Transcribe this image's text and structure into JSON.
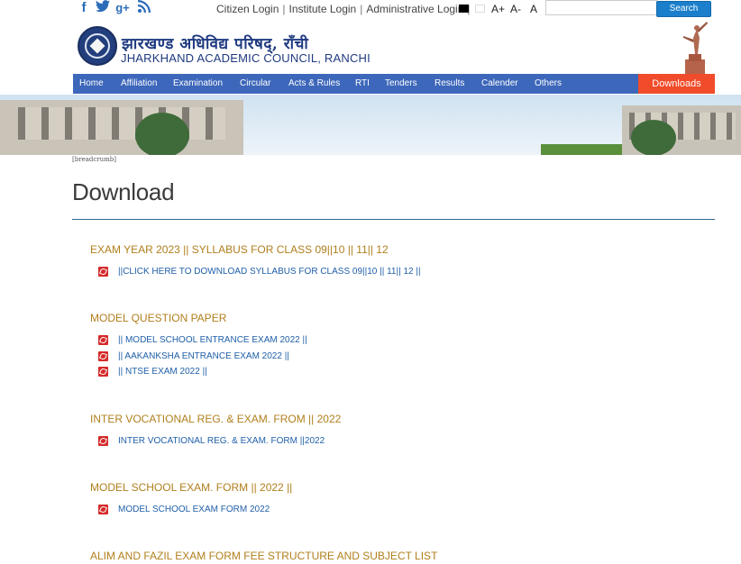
{
  "topbar": {
    "social": [
      {
        "name": "facebook-icon",
        "glyph": "f"
      },
      {
        "name": "twitter-icon",
        "glyph": "t"
      },
      {
        "name": "google-plus-icon",
        "glyph": "g+"
      },
      {
        "name": "rss-icon",
        "glyph": "rss"
      }
    ],
    "links": [
      "Citizen Login",
      "Institute Login",
      "Administrative Login"
    ],
    "font_controls": [
      "A+",
      "A-",
      "A"
    ],
    "search_placeholder": "",
    "search_button": "Search"
  },
  "header": {
    "title_hindi": "झारखण्ड अधिविद्य परिषद्, राँची",
    "title_english": "JHARKHAND ACADEMIC COUNCIL, RANCHI"
  },
  "nav": {
    "items": [
      "Home",
      "Affiliation",
      "Examination",
      "Circular",
      "Acts & Rules",
      "RTI",
      "Tenders",
      "Results",
      "Calender",
      "Others"
    ],
    "downloads": "Downloads"
  },
  "breadcrumb": "[breadcrumb]",
  "page": {
    "title": "Download"
  },
  "sections": [
    {
      "heading": "EXAM YEAR 2023 || SYLLABUS FOR CLASS 09||10 || 11|| 12",
      "links": [
        "||CLICK HERE TO DOWNLOAD SYLLABUS FOR CLASS 09||10 || 11|| 12 ||"
      ]
    },
    {
      "heading": "MODEL QUESTION PAPER",
      "links": [
        "|| MODEL SCHOOL ENTRANCE EXAM 2022 ||",
        "|| AAKANKSHA ENTRANCE EXAM 2022 ||",
        "|| NTSE EXAM 2022 ||"
      ]
    },
    {
      "heading": "INTER VOCATIONAL REG. & EXAM. FROM || 2022",
      "links": [
        "INTER VOCATIONAL REG. & EXAM. FORM ||2022"
      ]
    },
    {
      "heading": "MODEL SCHOOL EXAM. FORM || 2022 ||",
      "links": [
        "MODEL SCHOOL EXAM FORM 2022"
      ]
    },
    {
      "heading": "ALIM AND FAZIL EXAM FORM FEE STRUCTURE AND SUBJECT LIST",
      "links": []
    }
  ],
  "colors": {
    "nav_bg": "#3d67ba",
    "downloads_bg": "#f04c2b",
    "heading": "#b07f1c",
    "link": "#1f5fa8"
  }
}
